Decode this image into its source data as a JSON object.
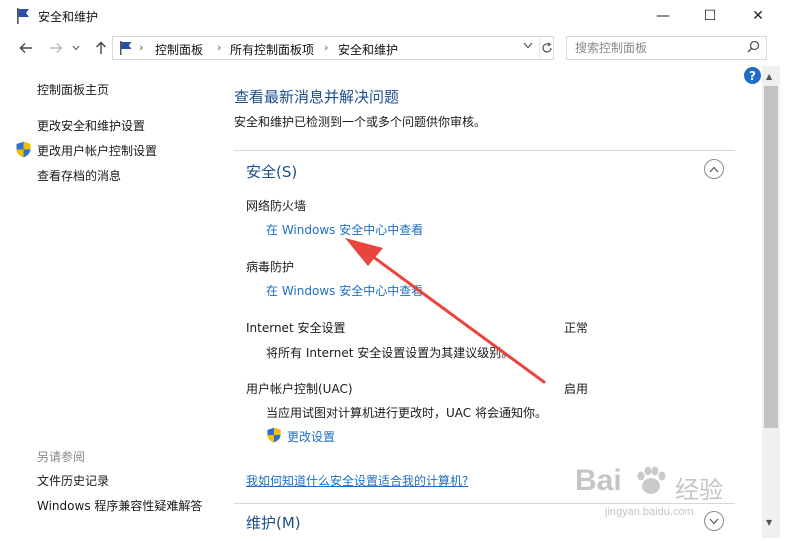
{
  "window": {
    "title": "安全和维护",
    "controls": {
      "minimize": "—",
      "maximize": "☐",
      "close": "✕"
    }
  },
  "nav": {
    "back_icon": "arrow-left-icon",
    "forward_icon": "arrow-right-icon",
    "up_icon": "arrow-up-icon",
    "breadcrumbs": [
      "控制面板",
      "所有控制面板项",
      "安全和维护"
    ],
    "search_placeholder": "搜索控制面板"
  },
  "sidebar": {
    "home": "控制面板主页",
    "links": [
      "更改安全和维护设置",
      "更改用户帐户控制设置",
      "查看存档的消息"
    ],
    "see_also_heading": "另请参阅",
    "see_also": [
      "文件历史记录",
      "Windows 程序兼容性疑难解答"
    ]
  },
  "main": {
    "title": "查看最新消息并解决问题",
    "description": "安全和维护已检测到一个或多个问题供你审核。",
    "security": {
      "title": "安全(S)",
      "items": [
        {
          "label": "网络防火墙",
          "link": "在 Windows 安全中心中查看"
        },
        {
          "label": "病毒防护",
          "link": "在 Windows 安全中心中查看"
        },
        {
          "label": "Internet 安全设置",
          "status": "正常",
          "desc": "将所有 Internet 安全设置设置为其建议级别。"
        },
        {
          "label": "用户帐户控制(UAC)",
          "status": "启用",
          "desc": "当应用试图对计算机进行更改时，UAC 将会通知你。",
          "link": "更改设置"
        }
      ],
      "help_link": "我如何知道什么安全设置适合我的计算机?"
    },
    "maintenance": {
      "title": "维护(M)"
    }
  },
  "watermark": {
    "brand": "Bai",
    "brand2": "经验",
    "url": "jingyan.baidu.com"
  },
  "colors": {
    "link": "#1e6fc4",
    "heading": "#1e4e8c",
    "arrow": "#e8453c"
  }
}
